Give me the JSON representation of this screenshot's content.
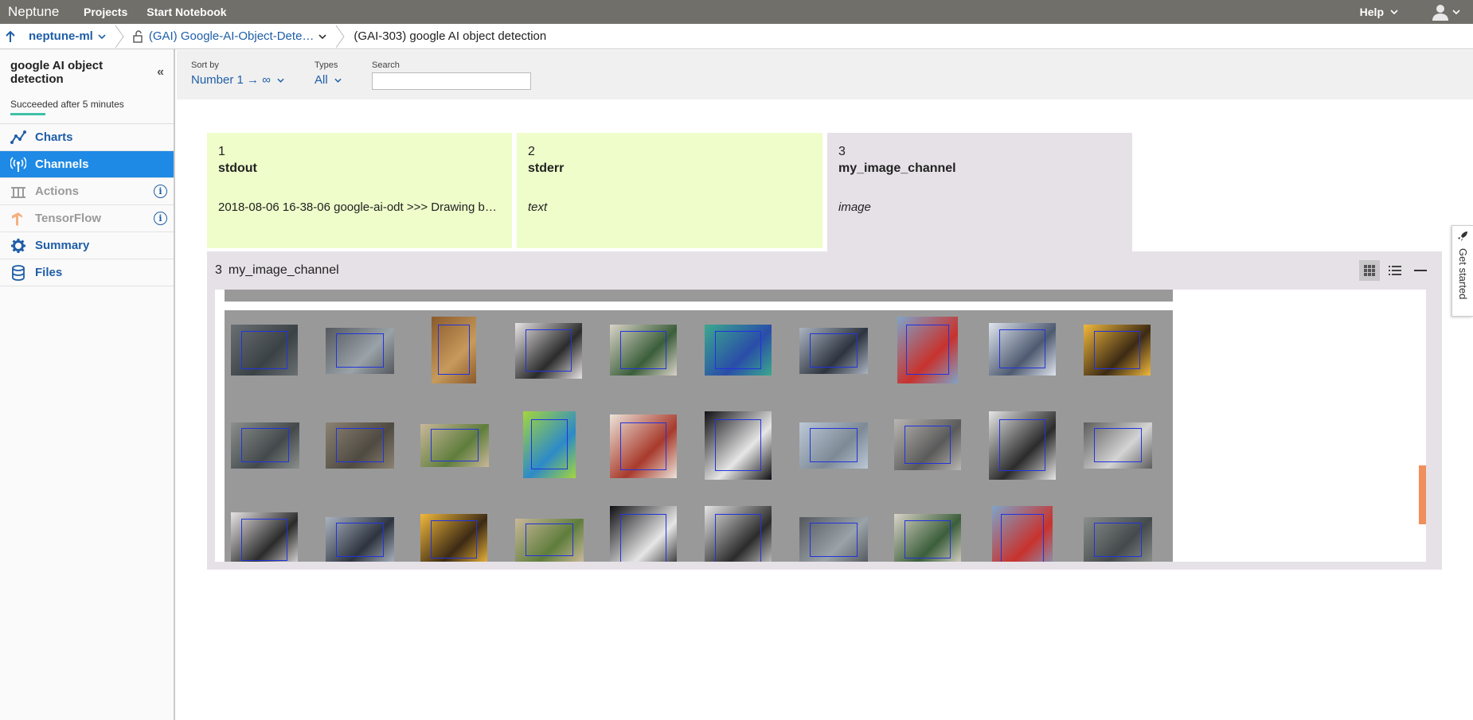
{
  "topbar": {
    "logo": "Neptune",
    "nav": [
      "Projects",
      "Start Notebook"
    ],
    "help": "Help"
  },
  "breadcrumb": {
    "project": "neptune-ml",
    "group": "(GAI) Google-AI-Object-Dete…",
    "current": "(GAI-303) google AI object detection"
  },
  "sidebar": {
    "title": "google AI object detection",
    "status": "Succeeded after 5 minutes",
    "items": [
      {
        "label": "Charts",
        "icon": "chart-line-icon",
        "state": "normal"
      },
      {
        "label": "Channels",
        "icon": "antenna-icon",
        "state": "active"
      },
      {
        "label": "Actions",
        "icon": "actions-icon",
        "state": "disabled"
      },
      {
        "label": "TensorFlow",
        "icon": "tensorflow-icon",
        "state": "disabled"
      },
      {
        "label": "Summary",
        "icon": "gear-icon",
        "state": "normal"
      },
      {
        "label": "Files",
        "icon": "database-icon",
        "state": "normal"
      }
    ]
  },
  "filters": {
    "sort_label": "Sort by",
    "sort_value": "Number 1 → ∞",
    "types_label": "Types",
    "types_value": "All",
    "search_label": "Search",
    "search_value": ""
  },
  "channels": [
    {
      "num": "1",
      "name": "stdout",
      "desc": "2018-08-06 16-38-06 google-ai-odt >>> Drawing bo…",
      "kind": "text"
    },
    {
      "num": "2",
      "name": "stderr",
      "desc": "text",
      "kind": "text"
    },
    {
      "num": "3",
      "name": "my_image_channel",
      "desc": "image",
      "kind": "image"
    }
  ],
  "panel": {
    "num": "3",
    "name": "my_image_channel"
  },
  "get_started": "Get started",
  "colors": {
    "topbar": "#706f6a",
    "link": "#1f5ea7",
    "active": "#1e8ae6",
    "text_channel": "#eefdca",
    "image_channel": "#e6e1e7",
    "scroll_indicator": "#f08e5c"
  }
}
